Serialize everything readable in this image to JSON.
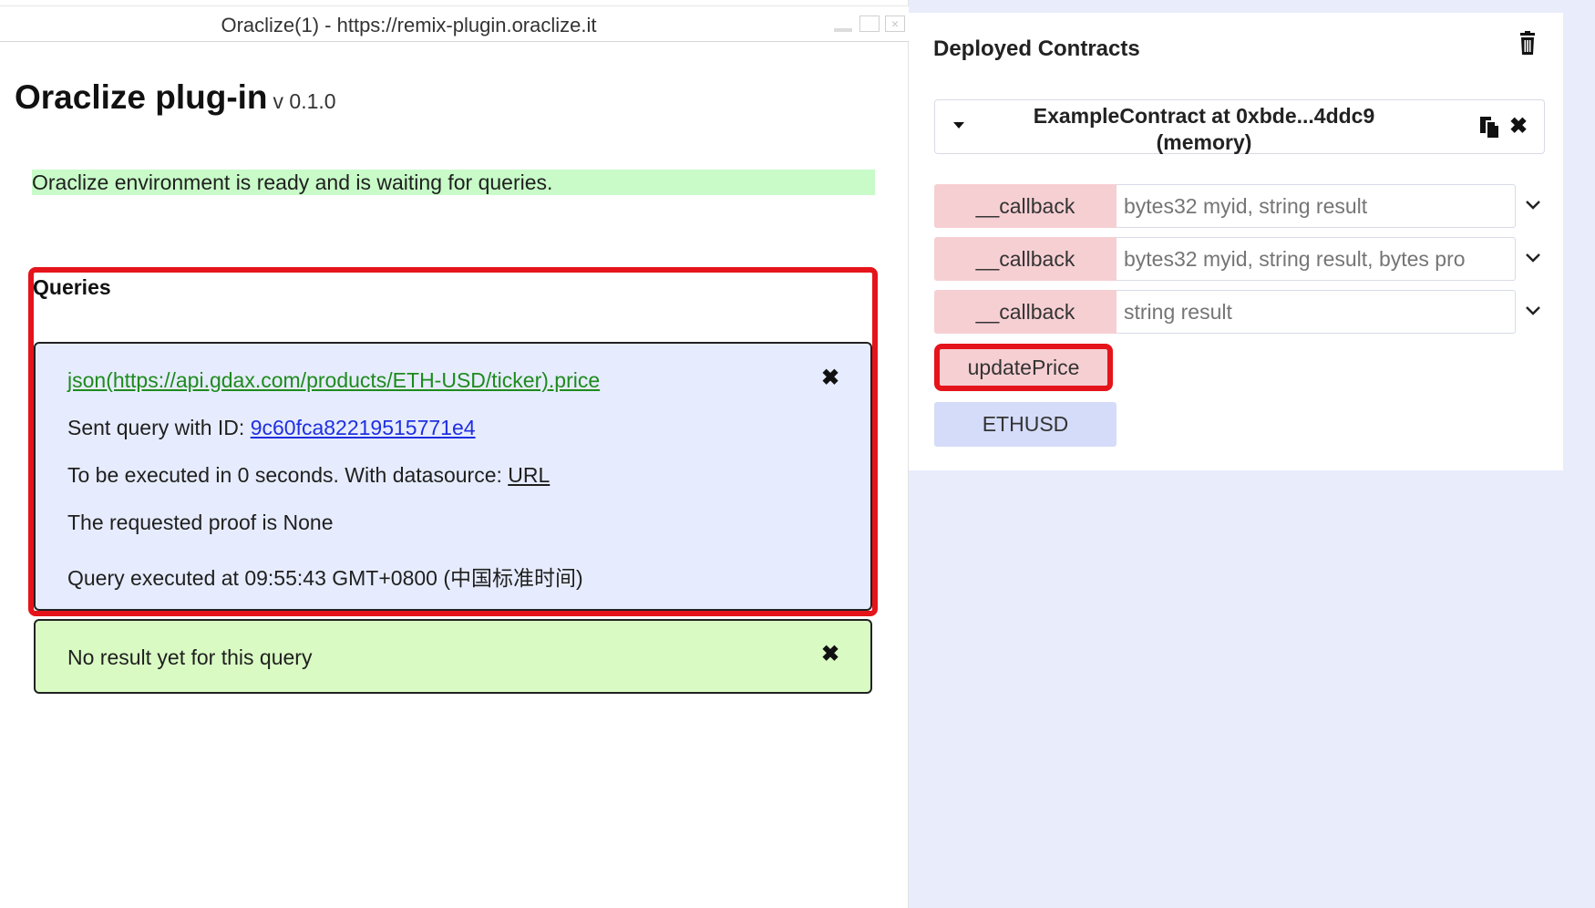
{
  "window": {
    "title": "Oraclize(1) - https://remix-plugin.oraclize.it"
  },
  "plugin": {
    "title": "Oraclize plug-in",
    "version": "v 0.1.0",
    "status": "Oraclize environment is ready and is waiting for queries.",
    "queries_label": "Queries",
    "query": {
      "url": "json(https://api.gdax.com/products/ETH-USD/ticker).price",
      "sent_prefix": "Sent query with ID: ",
      "query_id": "9c60fca82219515771e4",
      "exec_prefix": "To be executed in 0 seconds. With datasource: ",
      "datasource": "URL",
      "proof": "The requested proof is None",
      "executed": "Query executed at 09:55:43 GMT+0800 (中国标准时间)",
      "close_glyph": "✖"
    },
    "result": {
      "text": "No result yet for this query",
      "close_glyph": "✖"
    }
  },
  "deployed": {
    "title": "Deployed Contracts",
    "contract": {
      "name_line1": "ExampleContract at 0xbde...4ddc9",
      "name_line2": "(memory)",
      "remove_glyph": "✖"
    },
    "functions": [
      {
        "label": "__callback",
        "placeholder": "bytes32 myid, string result"
      },
      {
        "label": "__callback",
        "placeholder": "bytes32 myid, string result, bytes pro"
      },
      {
        "label": "__callback",
        "placeholder": "string result"
      }
    ],
    "update_button": "updatePrice",
    "ethusd_button": "ETHUSD"
  },
  "colors": {
    "highlight_red": "#e5141b",
    "status_green": "#c8fbc8",
    "query_card": "#e6ecfd",
    "result_card": "#d9fbc3",
    "transact_pink": "#f6cfd3",
    "call_blue": "#d5dcf9",
    "remix_bg": "#e8ecfb"
  }
}
